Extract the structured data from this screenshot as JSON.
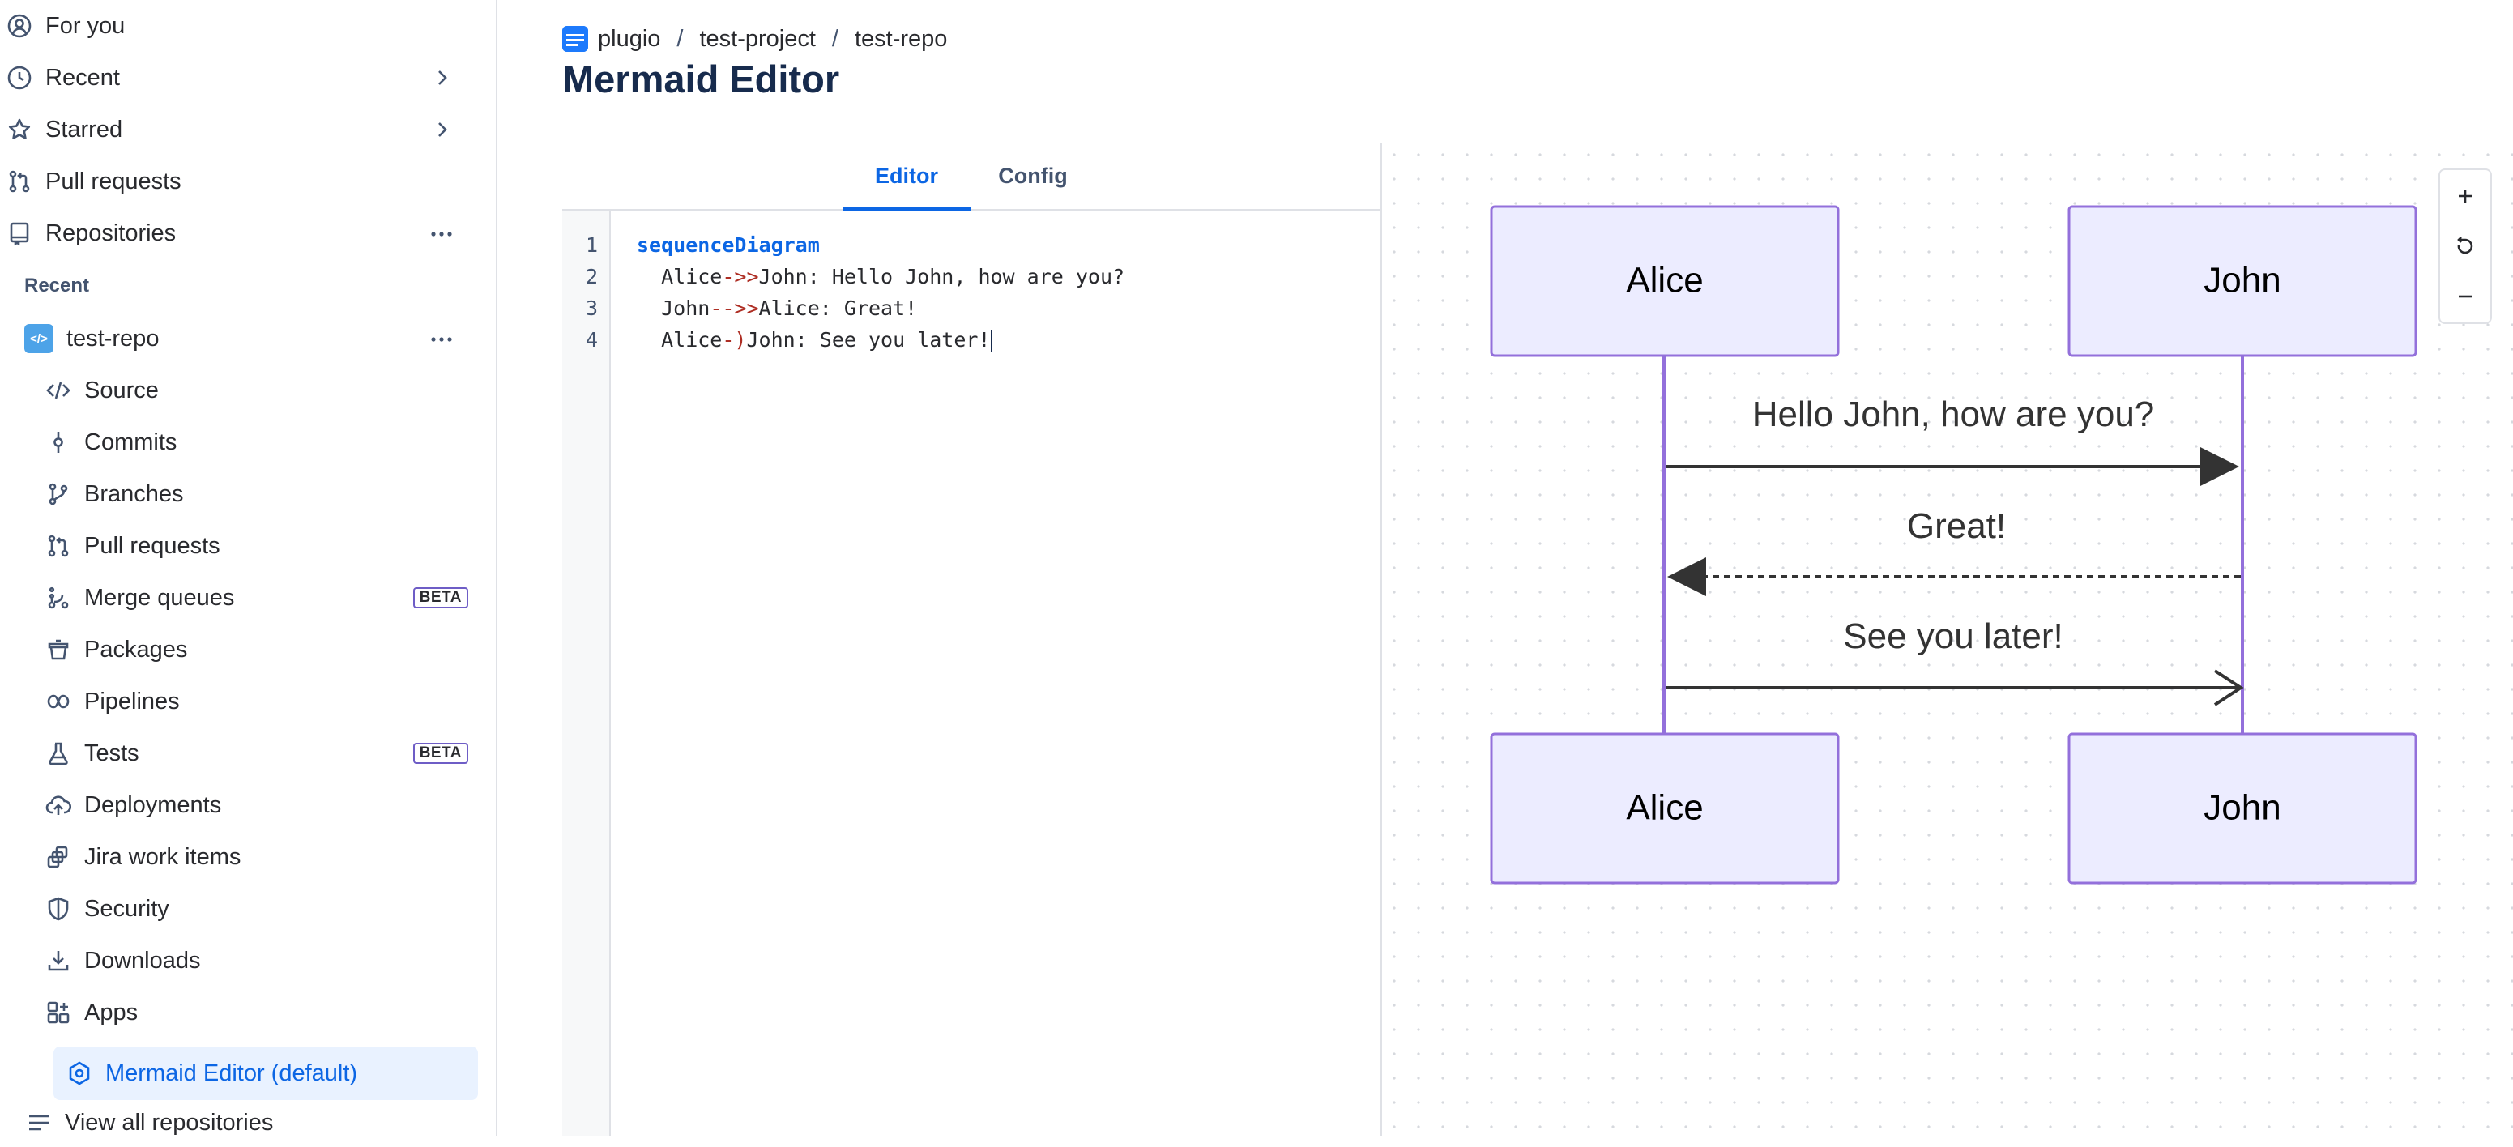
{
  "sidebar": {
    "top_items": [
      {
        "label": "For you",
        "icon": "person-circle-icon"
      },
      {
        "label": "Recent",
        "icon": "clock-icon"
      },
      {
        "label": "Starred",
        "icon": "star-icon"
      },
      {
        "label": "Pull requests",
        "icon": "pull-request-icon"
      },
      {
        "label": "Repositories",
        "icon": "repository-icon"
      }
    ],
    "recent_heading": "Recent",
    "repo": {
      "name": "test-repo",
      "tile_glyph": "</>"
    },
    "repo_items": [
      {
        "label": "Source",
        "icon": "code-icon"
      },
      {
        "label": "Commits",
        "icon": "commit-icon"
      },
      {
        "label": "Branches",
        "icon": "branch-icon"
      },
      {
        "label": "Pull requests",
        "icon": "pull-request-icon"
      },
      {
        "label": "Merge queues",
        "icon": "merge-queue-icon",
        "badge": "BETA"
      },
      {
        "label": "Packages",
        "icon": "package-icon"
      },
      {
        "label": "Pipelines",
        "icon": "pipelines-icon"
      },
      {
        "label": "Tests",
        "icon": "beaker-icon",
        "badge": "BETA"
      },
      {
        "label": "Deployments",
        "icon": "cloud-upload-icon"
      },
      {
        "label": "Jira work items",
        "icon": "jira-icon"
      },
      {
        "label": "Security",
        "icon": "shield-icon"
      },
      {
        "label": "Downloads",
        "icon": "download-icon"
      },
      {
        "label": "Apps",
        "icon": "apps-grid-icon"
      }
    ],
    "active_item": {
      "label": "Mermaid Editor (default)",
      "icon": "hexagon-settings-icon"
    },
    "view_all": {
      "label": "View all repositories",
      "icon": "list-icon"
    }
  },
  "header": {
    "breadcrumb": [
      "plugio",
      "test-project",
      "test-repo"
    ],
    "title": "Mermaid Editor"
  },
  "editor": {
    "tabs": [
      {
        "label": "Editor",
        "active": true
      },
      {
        "label": "Config",
        "active": false
      }
    ],
    "line_numbers": [
      "1",
      "2",
      "3",
      "4"
    ],
    "code": [
      [
        {
          "t": "sequenceDiagram",
          "c": "kw"
        }
      ],
      [
        {
          "t": "  Alice"
        },
        {
          "t": "->>",
          "c": "op"
        },
        {
          "t": "John: Hello John, how are you?"
        }
      ],
      [
        {
          "t": "  John"
        },
        {
          "t": "-->>",
          "c": "op"
        },
        {
          "t": "Alice: Great!"
        }
      ],
      [
        {
          "t": "  Alice"
        },
        {
          "t": "-)",
          "c": "op"
        },
        {
          "t": "John: See you later!"
        }
      ]
    ]
  },
  "preview": {
    "zoom_controls": [
      {
        "icon": "plus-icon"
      },
      {
        "icon": "reset-icon"
      },
      {
        "icon": "minus-icon"
      }
    ],
    "diagram": {
      "type": "sequence",
      "participants": [
        "Alice",
        "John"
      ],
      "messages": [
        {
          "from": "Alice",
          "to": "John",
          "text": "Hello John, how are you?",
          "style": "solid",
          "arrow": "filled"
        },
        {
          "from": "John",
          "to": "Alice",
          "text": "Great!",
          "style": "dashed",
          "arrow": "filled"
        },
        {
          "from": "Alice",
          "to": "John",
          "text": "See you later!",
          "style": "solid",
          "arrow": "open"
        }
      ],
      "colors": {
        "actor_fill": "#ececff",
        "actor_stroke": "#9370db",
        "lifeline": "#9370db",
        "message": "#333333"
      }
    }
  },
  "colors": {
    "accent": "#0c66e4",
    "beta_border": "#6e5dc6",
    "active_bg": "#e9f2ff"
  }
}
